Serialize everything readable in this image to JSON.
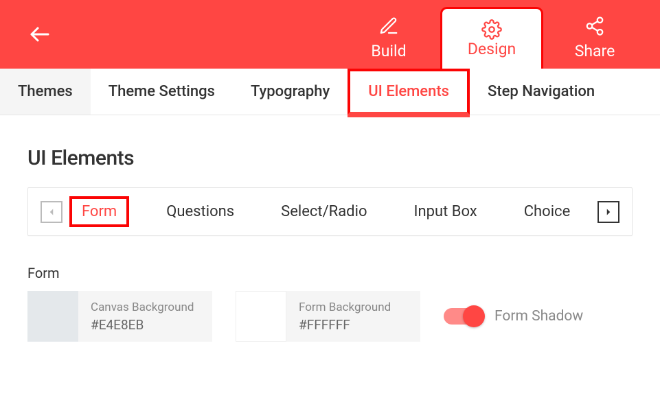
{
  "header": {
    "tabs": [
      {
        "id": "build",
        "label": "Build",
        "active": false
      },
      {
        "id": "design",
        "label": "Design",
        "active": true
      },
      {
        "id": "share",
        "label": "Share",
        "active": false
      }
    ]
  },
  "subnav": {
    "items": [
      {
        "id": "themes",
        "label": "Themes",
        "active": false
      },
      {
        "id": "theme-settings",
        "label": "Theme Settings",
        "active": false
      },
      {
        "id": "typography",
        "label": "Typography",
        "active": false
      },
      {
        "id": "ui-elements",
        "label": "UI Elements",
        "active": true
      },
      {
        "id": "step-navigation",
        "label": "Step Navigation",
        "active": false
      }
    ]
  },
  "page": {
    "title": "UI Elements"
  },
  "tabstrip": {
    "items": [
      {
        "id": "form",
        "label": "Form",
        "active": true
      },
      {
        "id": "questions",
        "label": "Questions",
        "active": false
      },
      {
        "id": "select-radio",
        "label": "Select/Radio",
        "active": false
      },
      {
        "id": "input-box",
        "label": "Input Box",
        "active": false
      },
      {
        "id": "choice",
        "label": "Choice",
        "active": false
      }
    ]
  },
  "section": {
    "label": "Form",
    "canvas_bg": {
      "label": "Canvas Background",
      "value": "#E4E8EB",
      "swatch": "#E4E8EB"
    },
    "form_bg": {
      "label": "Form Background",
      "value": "#FFFFFF",
      "swatch": "#FFFFFF"
    },
    "shadow": {
      "label": "Form Shadow",
      "on": true
    }
  },
  "colors": {
    "accent": "#ff4643",
    "highlight": "#fb0404"
  }
}
